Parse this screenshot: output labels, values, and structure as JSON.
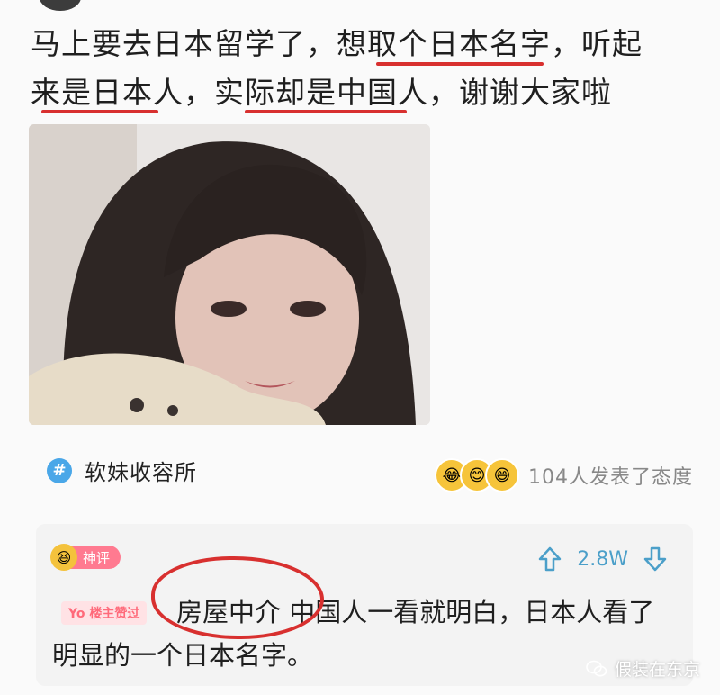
{
  "post": {
    "line1": "马上要去日本留学了，想取个日本名字，听起",
    "line2": "来是日本人，实际却是中国人，谢谢大家啦"
  },
  "topic": {
    "label": "软妹收容所",
    "icon": "hash-icon"
  },
  "reactions": {
    "summary": "104人发表了态度"
  },
  "comment": {
    "badge_label": "神评",
    "op_badge": "Yo 楼主赞过",
    "vote_count": "2.8W",
    "text": "房屋中介 中国人一看就明白，日本人看了明显的一个日本名字。"
  },
  "watermark": {
    "label": "假装在东京"
  },
  "colors": {
    "underline": "#d8302f",
    "accent": "#4aa7e8",
    "vote": "#4b9fc9"
  }
}
